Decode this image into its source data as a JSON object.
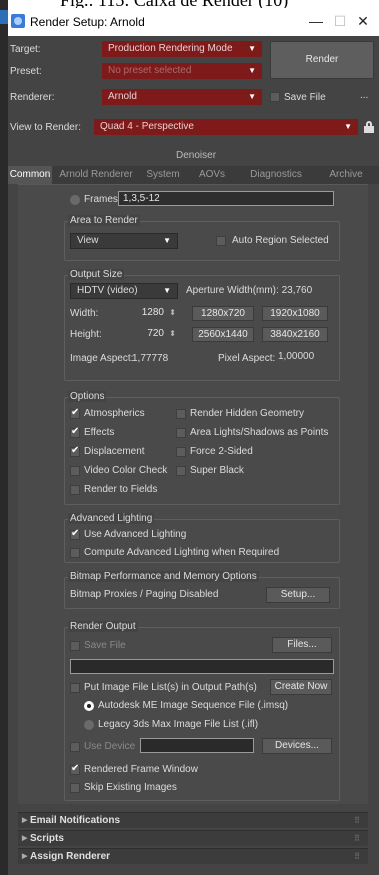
{
  "caption": "Fig.: 115: Caixa de Render (10)",
  "window": {
    "title": "Render Setup: Arnold",
    "minimize": "—",
    "maximize": "☐",
    "close": "✕"
  },
  "header": {
    "target_label": "Target:",
    "target_value": "Production Rendering Mode",
    "preset_label": "Preset:",
    "preset_value": "No preset selected",
    "renderer_label": "Renderer:",
    "renderer_value": "Arnold",
    "save_file_label": "Save File",
    "more_label": "...",
    "render_button": "Render",
    "view_label": "View to Render:",
    "view_value": "Quad 4 - Perspective",
    "denoiser_label": "Denoiser"
  },
  "tabs": [
    "Common",
    "Arnold Renderer",
    "System",
    "AOVs",
    "Diagnostics",
    "Archive"
  ],
  "frames": {
    "label": "Frames",
    "value": "1,3,5-12"
  },
  "area": {
    "title": "Area to Render",
    "value": "View",
    "auto_region": "Auto Region Selected"
  },
  "output_size": {
    "title": "Output Size",
    "preset": "HDTV (video)",
    "aperture": "Aperture Width(mm): 23,760",
    "width_label": "Width:",
    "width_value": "1280",
    "height_label": "Height:",
    "height_value": "720",
    "presets": [
      "1280x720",
      "1920x1080",
      "2560x1440",
      "3840x2160"
    ],
    "image_aspect_label": "Image Aspect:",
    "image_aspect_value": "1,77778",
    "pixel_aspect_label": "Pixel Aspect:",
    "pixel_aspect_value": "1,00000"
  },
  "options": {
    "title": "Options",
    "left": [
      {
        "label": "Atmospherics",
        "checked": true
      },
      {
        "label": "Effects",
        "checked": true
      },
      {
        "label": "Displacement",
        "checked": true
      },
      {
        "label": "Video Color Check",
        "checked": false
      },
      {
        "label": "Render to Fields",
        "checked": false
      }
    ],
    "right": [
      {
        "label": "Render Hidden Geometry",
        "checked": false
      },
      {
        "label": "Area Lights/Shadows as Points",
        "checked": false
      },
      {
        "label": "Force 2-Sided",
        "checked": false
      },
      {
        "label": "Super Black",
        "checked": false
      }
    ]
  },
  "advanced_lighting": {
    "title": "Advanced Lighting",
    "use": "Use Advanced Lighting",
    "compute": "Compute Advanced Lighting when Required"
  },
  "bitmap": {
    "title": "Bitmap Performance and Memory Options",
    "status": "Bitmap Proxies / Paging Disabled",
    "setup_button": "Setup..."
  },
  "render_output": {
    "title": "Render Output",
    "save_file": "Save File",
    "files_button": "Files...",
    "path_value": "",
    "put_list": "Put Image File List(s) in Output Path(s)",
    "create_now": "Create Now",
    "autodesk_option": "Autodesk ME Image Sequence File (.imsq)",
    "legacy_option": "Legacy 3ds Max Image File List (.ifl)",
    "use_device": "Use Device",
    "devices_button": "Devices...",
    "rendered_frame": "Rendered Frame Window",
    "skip_existing": "Skip Existing Images"
  },
  "rollouts": [
    "Email Notifications",
    "Scripts",
    "Assign Renderer"
  ],
  "colors": {
    "window_bg": "#444444",
    "field_red": "#7e1a1a",
    "tab_active": "#555555"
  }
}
